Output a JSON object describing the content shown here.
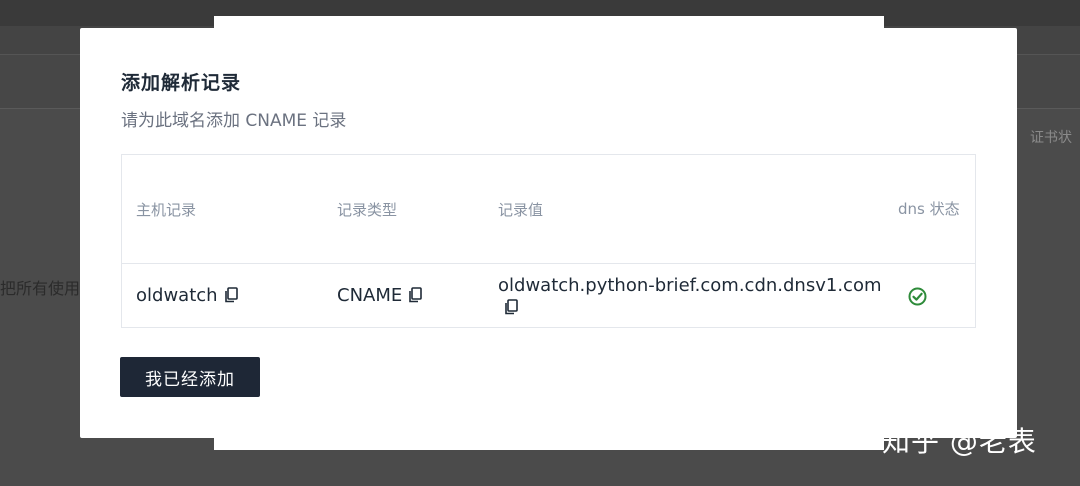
{
  "background": {
    "column_label": "证书状",
    "side_text": "把所有使用"
  },
  "modal": {
    "title": "添加解析记录",
    "subtitle": "请为此域名添加 CNAME 记录",
    "table": {
      "headers": {
        "host": "主机记录",
        "type": "记录类型",
        "value": "记录值",
        "dns_status": "dns 状态"
      },
      "rows": [
        {
          "host": "oldwatch",
          "type": "CNAME",
          "value": "oldwatch.python-brief.com.cdn.dnsv1.com",
          "status_icon": "check-circle-icon",
          "status_color": "#2e8b3a"
        }
      ],
      "copy_icon": "copy-icon"
    },
    "confirm_button_label": "我已经添加",
    "button_color": "#1e2736"
  },
  "watermark": "知乎 @老表"
}
